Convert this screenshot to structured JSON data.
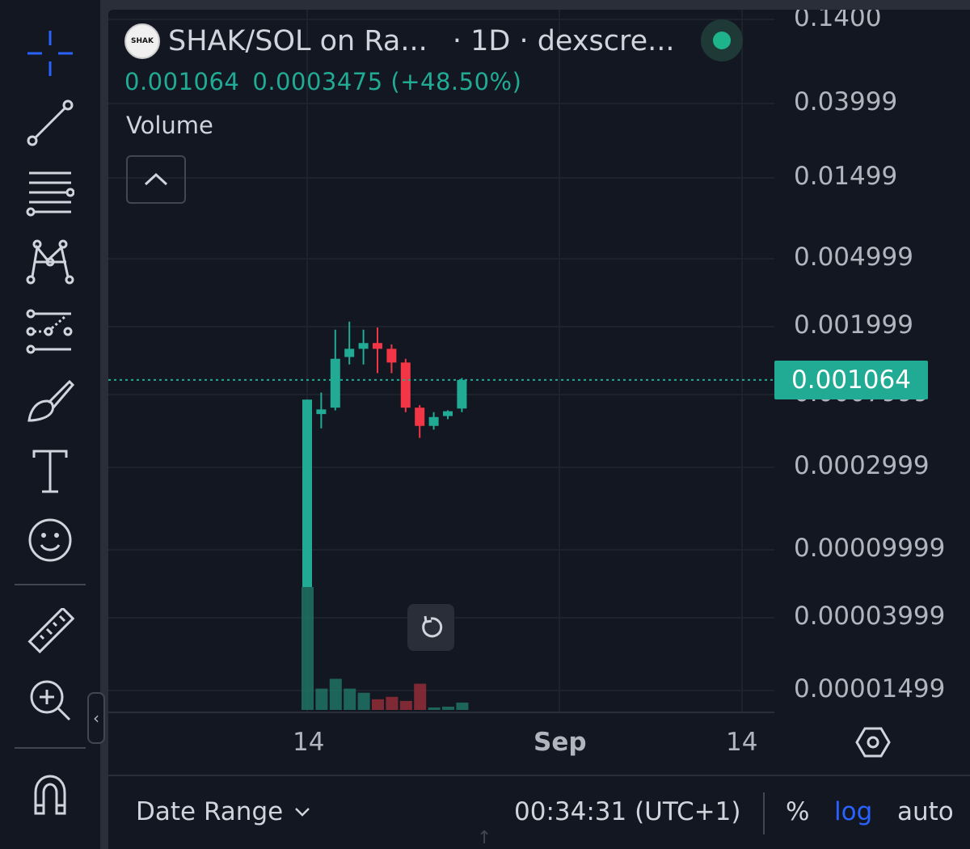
{
  "toolbar": {
    "tools": [
      {
        "name": "crosshair-icon"
      },
      {
        "name": "trend-line-icon"
      },
      {
        "name": "fib-retracement-icon"
      },
      {
        "name": "pattern-icon"
      },
      {
        "name": "prediction-icon"
      },
      {
        "name": "brush-icon"
      },
      {
        "name": "text-icon"
      },
      {
        "name": "emoji-icon"
      },
      {
        "name": "ruler-icon"
      },
      {
        "name": "zoom-in-icon"
      },
      {
        "name": "magnet-icon"
      }
    ],
    "collapse_glyph": "‹"
  },
  "legend": {
    "logo_text": "SHAK",
    "symbol": "SHAK/SOL on Ra...",
    "interval": "· 1D · dexscre...",
    "price": "0.001064",
    "change": "0.0003475 (+48.50%)",
    "status_color": "#1db48c"
  },
  "volume_label": "Volume",
  "price_axis": {
    "labels": [
      "0.1400",
      "0.03999",
      "0.01499",
      "0.004999",
      "0.001999",
      "0.0007999",
      "0.0002999",
      "0.00009999",
      "0.00003999",
      "0.00001499"
    ],
    "current_price": "0.001064",
    "scale": "log"
  },
  "time_axis": {
    "labels": [
      "14",
      "Sep",
      "14"
    ]
  },
  "chart_data": {
    "type": "candlestick",
    "scale": "log",
    "candles": [
      {
        "o": 2e-06,
        "h": 0.00055,
        "l": 2e-06,
        "c": 0.00075
      },
      {
        "o": 0.00058,
        "h": 0.00085,
        "l": 0.00045,
        "c": 0.00063
      },
      {
        "o": 0.00065,
        "h": 0.0026,
        "l": 0.00062,
        "c": 0.00155
      },
      {
        "o": 0.0016,
        "h": 0.003,
        "l": 0.0014,
        "c": 0.00185
      },
      {
        "o": 0.00185,
        "h": 0.0026,
        "l": 0.0014,
        "c": 0.00205
      },
      {
        "o": 0.00205,
        "h": 0.0027,
        "l": 0.0012,
        "c": 0.00185
      },
      {
        "o": 0.00185,
        "h": 0.002,
        "l": 0.0012,
        "c": 0.00145
      },
      {
        "o": 0.00145,
        "h": 0.00155,
        "l": 0.0006,
        "c": 0.00065
      },
      {
        "o": 0.00065,
        "h": 0.00068,
        "l": 0.00038,
        "c": 0.00047
      },
      {
        "o": 0.00047,
        "h": 0.0006,
        "l": 0.00044,
        "c": 0.00055
      },
      {
        "o": 0.00056,
        "h": 0.00062,
        "l": 0.00053,
        "c": 0.00061
      },
      {
        "o": 0.00064,
        "h": 0.0011,
        "l": 0.0006,
        "c": 0.001064
      }
    ],
    "volume": [
      150,
      26,
      38,
      26,
      21,
      13,
      16,
      11,
      32,
      3,
      4,
      9
    ],
    "colors": {
      "up": "#22ab94",
      "down": "#f23645"
    }
  },
  "bottom_bar": {
    "date_range": "Date Range",
    "clock": "00:34:31 (UTC+1)",
    "percent": "%",
    "log": "log",
    "auto": "auto"
  }
}
